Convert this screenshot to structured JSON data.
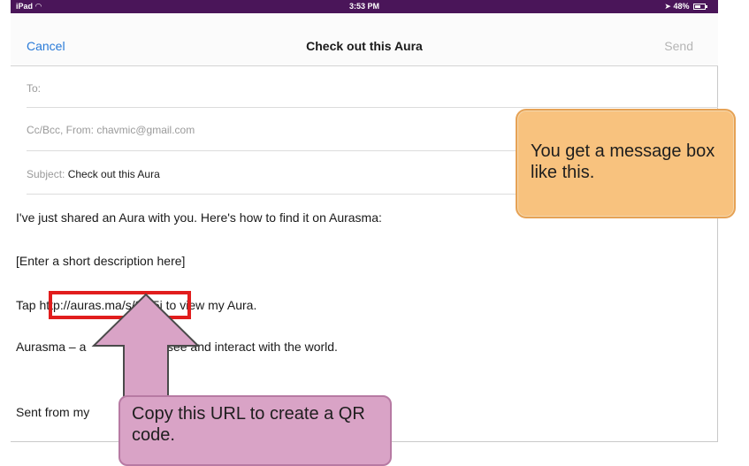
{
  "status_bar": {
    "carrier": "iPad",
    "wifi_icon": "wifi-icon",
    "time": "3:53 PM",
    "battery_text": "48%",
    "battery_icon": "battery-icon"
  },
  "nav": {
    "cancel_label": "Cancel",
    "title": "Check out this Aura",
    "send_label": "Send"
  },
  "fields": {
    "to_label": "To:",
    "cc_label": "Cc/Bcc, From: chavmic@gmail.com",
    "subject_label": "Subject:",
    "subject_value": "Check out this Aura"
  },
  "body": {
    "intro": "I've just shared an Aura with you. Here's how to find it on Aurasma:",
    "description": "[Enter a short description here]",
    "tap_prefix": "Tap ",
    "url": "http://auras.ma/s/8iV5j",
    "tap_suffix": " to view my Aura.",
    "aurasma_prefix": "Aurasma – a",
    "aurasma_suffix": "to see and interact with the world.",
    "sent_from": "Sent from my"
  },
  "callouts": {
    "message_box_note": "You get a message box like this.",
    "copy_url_note": "Copy this URL to create a QR code."
  },
  "colors": {
    "status_bar_bg": "#4a1559",
    "link_blue": "#2a7bd8",
    "callout_orange": "#f8c27e",
    "callout_pink": "#d9a3c6",
    "highlight_red": "#e11d1d"
  }
}
